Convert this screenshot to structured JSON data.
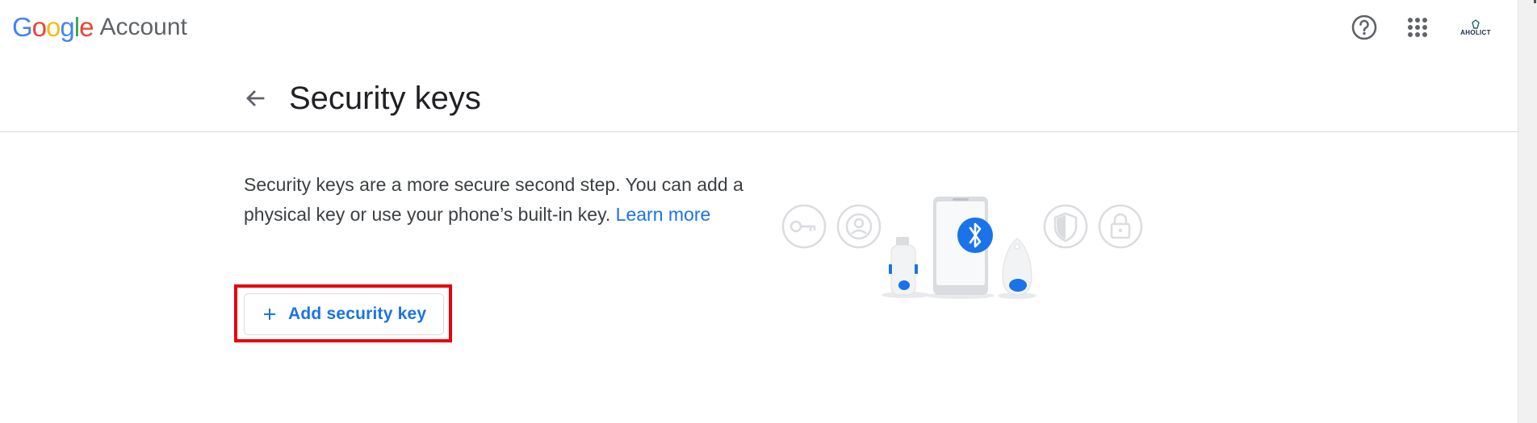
{
  "header": {
    "logo_letters": [
      {
        "ch": "G",
        "color": "#4285F4"
      },
      {
        "ch": "o",
        "color": "#EA4335"
      },
      {
        "ch": "o",
        "color": "#FBBC05"
      },
      {
        "ch": "g",
        "color": "#4285F4"
      },
      {
        "ch": "l",
        "color": "#34A853"
      },
      {
        "ch": "e",
        "color": "#EA4335"
      }
    ],
    "product_name": "Account",
    "help_icon": "help-circle-icon",
    "apps_icon": "apps-grid-icon",
    "avatar_text": "AHOLICT"
  },
  "page": {
    "title": "Security keys",
    "back_icon": "arrow-back-icon"
  },
  "content": {
    "description": "Security keys are a more secure second step. You can add a physical key or use your phone’s built-in key.",
    "learn_more": "Learn more",
    "add_button": {
      "icon": "plus-icon",
      "label": "Add security key"
    }
  },
  "illustration": {
    "icons": [
      "key-icon",
      "user-circle-icon",
      "bluetooth-icon",
      "shield-icon",
      "lock-icon"
    ]
  },
  "colors": {
    "accent": "#1a73e8",
    "highlight_border": "#e8000d"
  }
}
